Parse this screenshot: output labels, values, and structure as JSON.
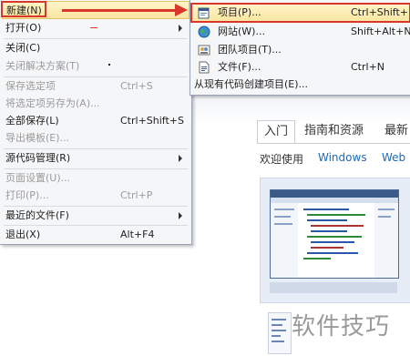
{
  "file_menu": {
    "items": [
      {
        "label": "新建(N)",
        "shortcut": "",
        "submenu": true,
        "disabled": false,
        "highlighted": true
      },
      {
        "label": "打开(O)",
        "shortcut": "",
        "submenu": true,
        "disabled": false
      },
      {
        "label": "关闭(C)",
        "shortcut": "",
        "submenu": false,
        "disabled": false
      },
      {
        "label": "关闭解决方案(T)",
        "shortcut": "",
        "submenu": false,
        "disabled": true
      },
      {
        "label": "保存选定项",
        "shortcut": "Ctrl+S",
        "submenu": false,
        "disabled": true
      },
      {
        "label": "将选定项另存为(A)...",
        "shortcut": "",
        "submenu": false,
        "disabled": true
      },
      {
        "label": "全部保存(L)",
        "shortcut": "Ctrl+Shift+S",
        "submenu": false,
        "disabled": false
      },
      {
        "label": "导出模板(E)...",
        "shortcut": "",
        "submenu": false,
        "disabled": true
      },
      {
        "label": "源代码管理(R)",
        "shortcut": "",
        "submenu": true,
        "disabled": false
      },
      {
        "label": "页面设置(U)...",
        "shortcut": "",
        "submenu": false,
        "disabled": true
      },
      {
        "label": "打印(P)...",
        "shortcut": "Ctrl+P",
        "submenu": false,
        "disabled": true
      },
      {
        "label": "最近的文件(F)",
        "shortcut": "",
        "submenu": true,
        "disabled": false
      },
      {
        "label": "退出(X)",
        "shortcut": "Alt+F4",
        "submenu": false,
        "disabled": false
      }
    ]
  },
  "new_submenu": {
    "items": [
      {
        "label": "项目(P)...",
        "shortcut": "Ctrl+Shift+N",
        "icon": "project-icon",
        "highlighted": true
      },
      {
        "label": "网站(W)...",
        "shortcut": "Shift+Alt+N",
        "icon": "website-globe-icon"
      },
      {
        "label": "团队项目(T)...",
        "shortcut": "",
        "icon": "team-project-icon"
      },
      {
        "label": "文件(F)...",
        "shortcut": "Ctrl+N",
        "icon": "file-icon"
      },
      {
        "label": "从现有代码创建项目(E)...",
        "shortcut": "",
        "icon": ""
      }
    ]
  },
  "start_page": {
    "tabs": [
      "入门",
      "指南和资源",
      "最新"
    ],
    "active_tab": "入门",
    "sub_tabs": [
      "欢迎使用",
      "Windows",
      "Web"
    ]
  },
  "watermark": "软件技巧",
  "colors": {
    "highlight": "#fbe6a0",
    "annotation_red": "#d9372c",
    "link_blue": "#1e6ab8",
    "menu_bg": "#f5f6f8"
  }
}
